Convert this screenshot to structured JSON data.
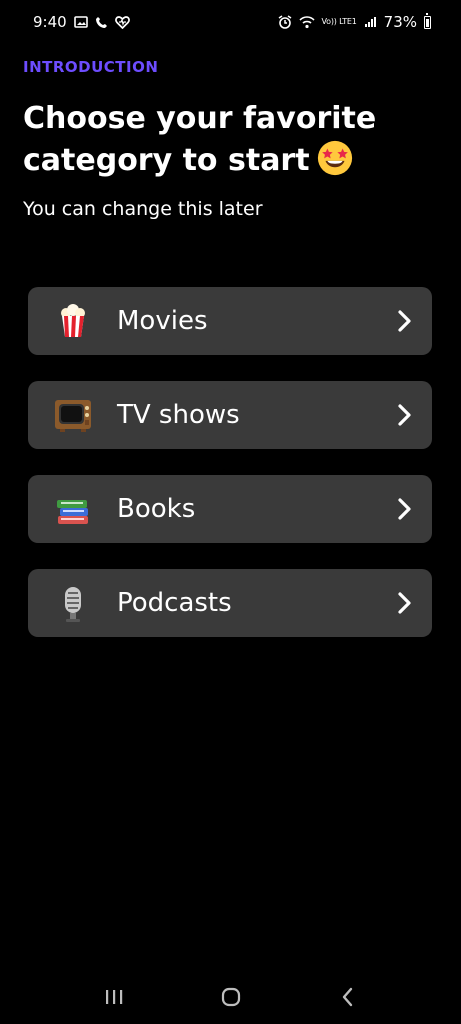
{
  "status_bar": {
    "time": "9:40",
    "battery": "73%",
    "network_label": "Vo)) LTE1"
  },
  "header": {
    "eyebrow": "INTRODUCTION",
    "title": "Choose your favorite category to start",
    "subtitle": "You can change this later"
  },
  "colors": {
    "background": "#000000",
    "accent": "#6d4dff",
    "card": "#3a3a3a",
    "text": "#ffffff"
  },
  "categories": [
    {
      "label": "Movies",
      "icon": "popcorn-icon"
    },
    {
      "label": "TV shows",
      "icon": "tv-icon"
    },
    {
      "label": "Books",
      "icon": "books-icon"
    },
    {
      "label": "Podcasts",
      "icon": "microphone-icon"
    }
  ],
  "navigation": {
    "items": [
      "recent-apps-icon",
      "home-icon",
      "back-icon"
    ]
  }
}
